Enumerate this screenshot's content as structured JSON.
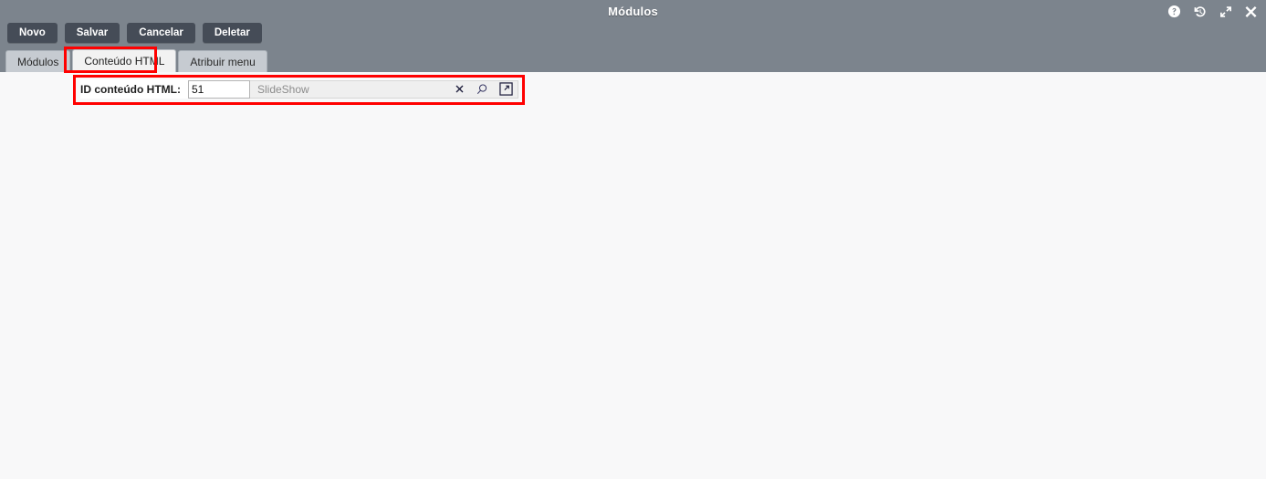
{
  "window": {
    "title": "Módulos",
    "controls": [
      {
        "name": "help-icon",
        "label": "Ajuda"
      },
      {
        "name": "history-icon",
        "label": "Histórico"
      },
      {
        "name": "expand-icon",
        "label": "Expandir"
      },
      {
        "name": "close-icon",
        "label": "Fechar"
      }
    ]
  },
  "toolbar": {
    "buttons": [
      {
        "label": "Novo"
      },
      {
        "label": "Salvar"
      },
      {
        "label": "Cancelar"
      },
      {
        "label": "Deletar"
      }
    ]
  },
  "tabs": [
    {
      "label": "Módulos",
      "active": false
    },
    {
      "label": "Conteúdo HTML",
      "active": true
    },
    {
      "label": "Atribuir menu",
      "active": false
    }
  ],
  "form": {
    "field_label": "ID conteúdo HTML:",
    "id_value": "51",
    "id_placeholder": "",
    "name_value": "SlideShow",
    "icons": [
      {
        "name": "clear-icon",
        "label": "Limpar"
      },
      {
        "name": "search-icon",
        "label": "Pesquisar"
      },
      {
        "name": "open-external-icon",
        "label": "Abrir"
      }
    ]
  },
  "colors": {
    "header_bg": "#7c848d",
    "content_bg": "#f8f8f9",
    "button_bg": "#454c57",
    "tab_inactive_bg": "#c6cbd1",
    "tab_active_bg": "#f2f2f2",
    "annotation": "#ff0000",
    "placeholder_text": "#8c8c8c"
  }
}
